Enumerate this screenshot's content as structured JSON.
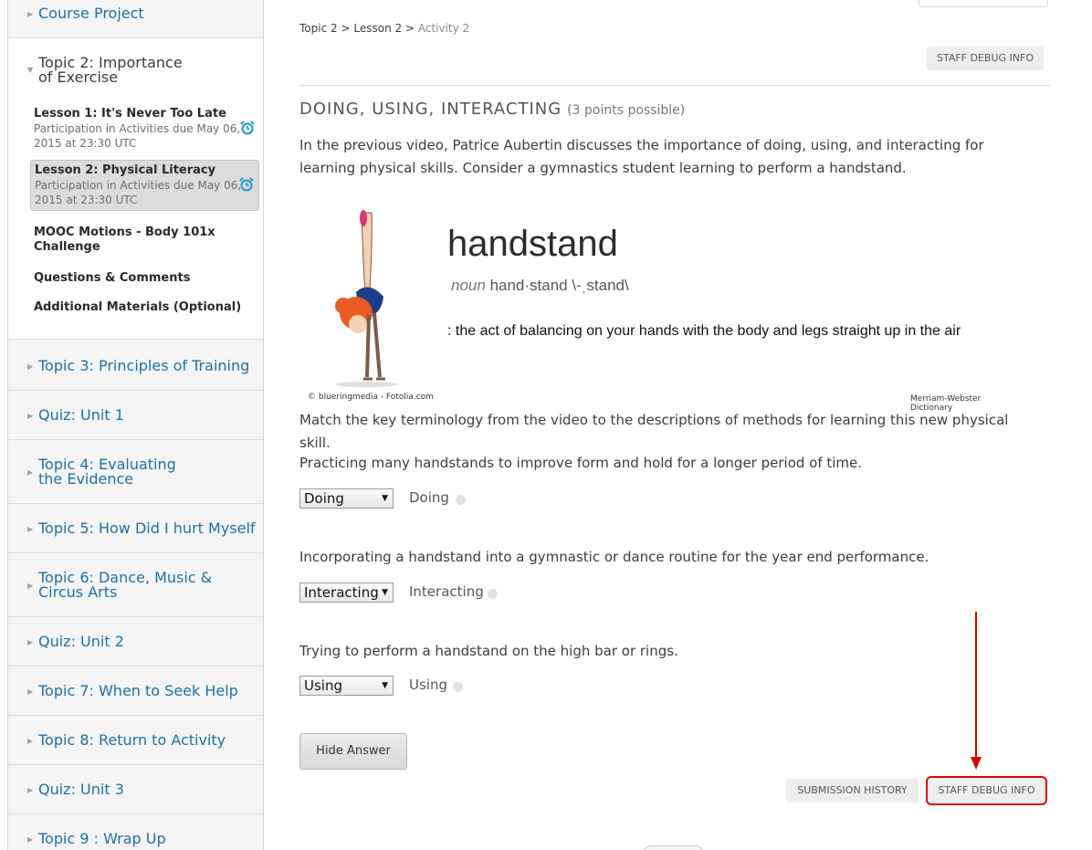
{
  "sidebar": {
    "course_project": "Course Project",
    "topic2": {
      "line1": "Topic 2: Importance",
      "line2": "of Exercise"
    },
    "lessons": [
      {
        "title": "Lesson 1: It's Never Too Late",
        "sub1": "Participation in Activities due May 06,",
        "sub2": "2015 at 23:30 UTC"
      },
      {
        "title": "Lesson 2: Physical Literacy",
        "sub1": "Participation in Activities due May 06,",
        "sub2": "2015 at 23:30 UTC"
      },
      {
        "title1": "MOOC Motions - Body 101x",
        "title2": "Challenge"
      },
      {
        "title": "Questions & Comments"
      },
      {
        "title": "Additional Materials (Optional)"
      }
    ],
    "chapters": [
      "Topic 3: Principles of Training",
      "Quiz: Unit 1",
      {
        "line1": "Topic 4: Evaluating",
        "line2": "the Evidence"
      },
      "Topic 5: How Did I hurt Myself",
      {
        "line1": "Topic 6: Dance, Music &",
        "line2": "Circus Arts"
      },
      "Quiz: Unit 2",
      "Topic 7: When to Seek Help",
      "Topic 8: Return to Activity",
      "Quiz: Unit 3",
      "Topic 9 : Wrap Up"
    ]
  },
  "breadcrumb": {
    "a": "Topic 2",
    "sep": ">",
    "b": "Lesson 2",
    "c": "Activity 2"
  },
  "staff_debug_top": "STAFF DEBUG INFO",
  "problem": {
    "title": "DOING, USING, INTERACTING",
    "points": "(3 points possible)",
    "intro": "In the previous video, Patrice Aubertin discusses the importance of doing, using, and interacting for learning physical skills. Consider a gymnastics student learning to perform a handstand.",
    "illustration": {
      "word": "handstand",
      "pos": "noun",
      "pron": "hand·stand \\-ˌstand\\",
      "definition": ": the act of balancing on your hands with the body and legs straight up in the air",
      "credit_left": "© blueringmedia - Fotolia.com",
      "credit_right": "Merriam-Webster Dictionary"
    },
    "instructions": "Match the key terminology from the video to the descriptions of methods for learning this new physical skill.",
    "questions": [
      {
        "text": "Practicing many handstands to improve form and hold for a longer period of time.",
        "selected": "Doing",
        "answer": "Doing"
      },
      {
        "text": "Incorporating a handstand into a gymnastic or dance routine for the year end performance.",
        "selected": "Interacting",
        "answer": "Interacting"
      },
      {
        "text": "Trying to perform a handstand on the high bar or rings.",
        "selected": "Using",
        "answer": "Using"
      }
    ],
    "hide_answer": "Hide Answer",
    "submission_history": "SUBMISSION HISTORY",
    "staff_debug_bottom": "STAFF DEBUG INFO"
  },
  "colors": {
    "link": "#1d6fa6",
    "highlight": "#e00000"
  }
}
